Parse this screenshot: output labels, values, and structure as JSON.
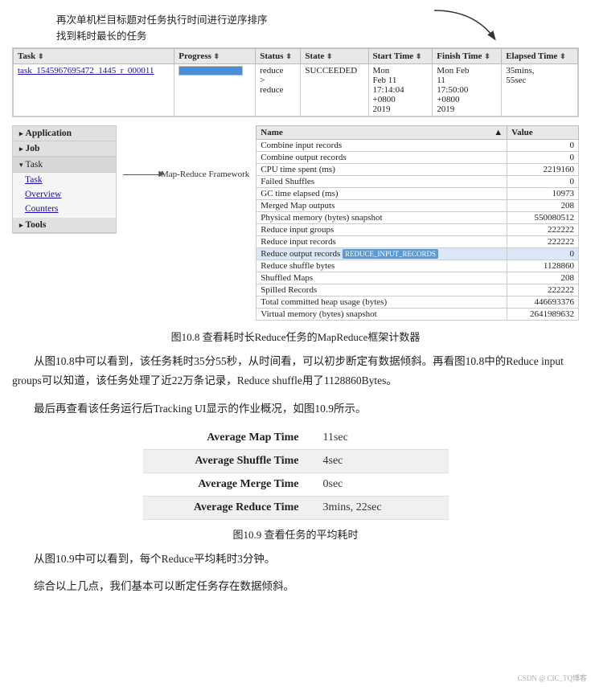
{
  "annotation": {
    "line1": "再次单机栏目标题对任务执行时间进行逆序排序",
    "line2": "找到耗时最长的任务"
  },
  "top_table": {
    "headers": [
      "Task",
      "Progress",
      "Status",
      "State",
      "Start Time",
      "Finish Time",
      "Elapsed Time"
    ],
    "rows": [
      {
        "task": "task_1545967695472_1445_r_000011",
        "progress": 100,
        "status": "reduce\n>\nreduce",
        "state": "SUCCEEDED",
        "start_time": "Mon Feb 11 17:14:04 +0800 2019",
        "finish_time": "Mon Feb 11 17:50:00 +0800 2019",
        "elapsed_time": "35mins, 55sec"
      }
    ]
  },
  "left_nav": {
    "items": [
      {
        "label": "Application",
        "type": "header"
      },
      {
        "label": "Job",
        "type": "header"
      },
      {
        "label": "Task",
        "type": "section"
      },
      {
        "label": "Task",
        "type": "sub-active"
      },
      {
        "label": "Overview",
        "type": "sub-active"
      },
      {
        "label": "Counters",
        "type": "sub-active"
      },
      {
        "label": "Tools",
        "type": "header"
      }
    ]
  },
  "mapreduce_label": "Map-Reduce Framework",
  "right_table": {
    "headers": [
      "Name",
      "Value"
    ],
    "rows": [
      {
        "name": "Combine input records",
        "value": "0",
        "highlight": false
      },
      {
        "name": "Combine output records",
        "value": "0",
        "highlight": false
      },
      {
        "name": "CPU time spent (ms)",
        "value": "2219160",
        "highlight": false
      },
      {
        "name": "Failed Shuffles",
        "value": "0",
        "highlight": false
      },
      {
        "name": "GC time elapsed (ms)",
        "value": "10973",
        "highlight": false
      },
      {
        "name": "Merged Map outputs",
        "value": "208",
        "highlight": false
      },
      {
        "name": "Physical memory (bytes) snapshot",
        "value": "550080512",
        "highlight": false
      },
      {
        "name": "Reduce input groups",
        "value": "222222",
        "highlight": false
      },
      {
        "name": "Reduce input records",
        "value": "222222",
        "highlight": false
      },
      {
        "name": "Reduce output records  REDUCE_INPUT_RECORDS",
        "value": "0",
        "highlight": true
      },
      {
        "name": "Reduce shuffle bytes",
        "value": "1128860",
        "highlight": false
      },
      {
        "name": "Shuffled Maps",
        "value": "208",
        "highlight": false
      },
      {
        "name": "Spilled Records",
        "value": "222222",
        "highlight": false
      },
      {
        "name": "Total committed heap usage (bytes)",
        "value": "446693376",
        "highlight": false
      },
      {
        "name": "Virtual memory (bytes) snapshot",
        "value": "2641989632",
        "highlight": false
      }
    ]
  },
  "figure1": {
    "caption": "图10.8   查看耗时长Reduce任务的MapReduce框架计数器"
  },
  "body_text1": "从图10.8中可以看到，该任务耗时35分55秒，从时间看，可以初步断定有数据倾斜。再看图10.8中的Reduce input groups可以知道，该任务处理了近22万条记录，Reduce shuffle用了1128860Bytes。",
  "body_text2": "最后再查看该任务运行后Tracking UI显示的作业概况，如图10.9所示。",
  "avg_time_table": {
    "rows": [
      {
        "label": "Average Map Time",
        "value": "11sec"
      },
      {
        "label": "Average Shuffle Time",
        "value": "4sec"
      },
      {
        "label": "Average Merge Time",
        "value": "0sec"
      },
      {
        "label": "Average Reduce Time",
        "value": "3mins, 22sec"
      }
    ]
  },
  "figure2": {
    "caption": "图10.9   查看任务的平均耗时"
  },
  "body_text3": "从图10.9中可以看到，每个Reduce平均耗时3分钟。",
  "body_text4": "综合以上几点，我们基本可以断定任务存在数据倾斜。",
  "watermark": "CSDN @ CIC_TQ博客"
}
